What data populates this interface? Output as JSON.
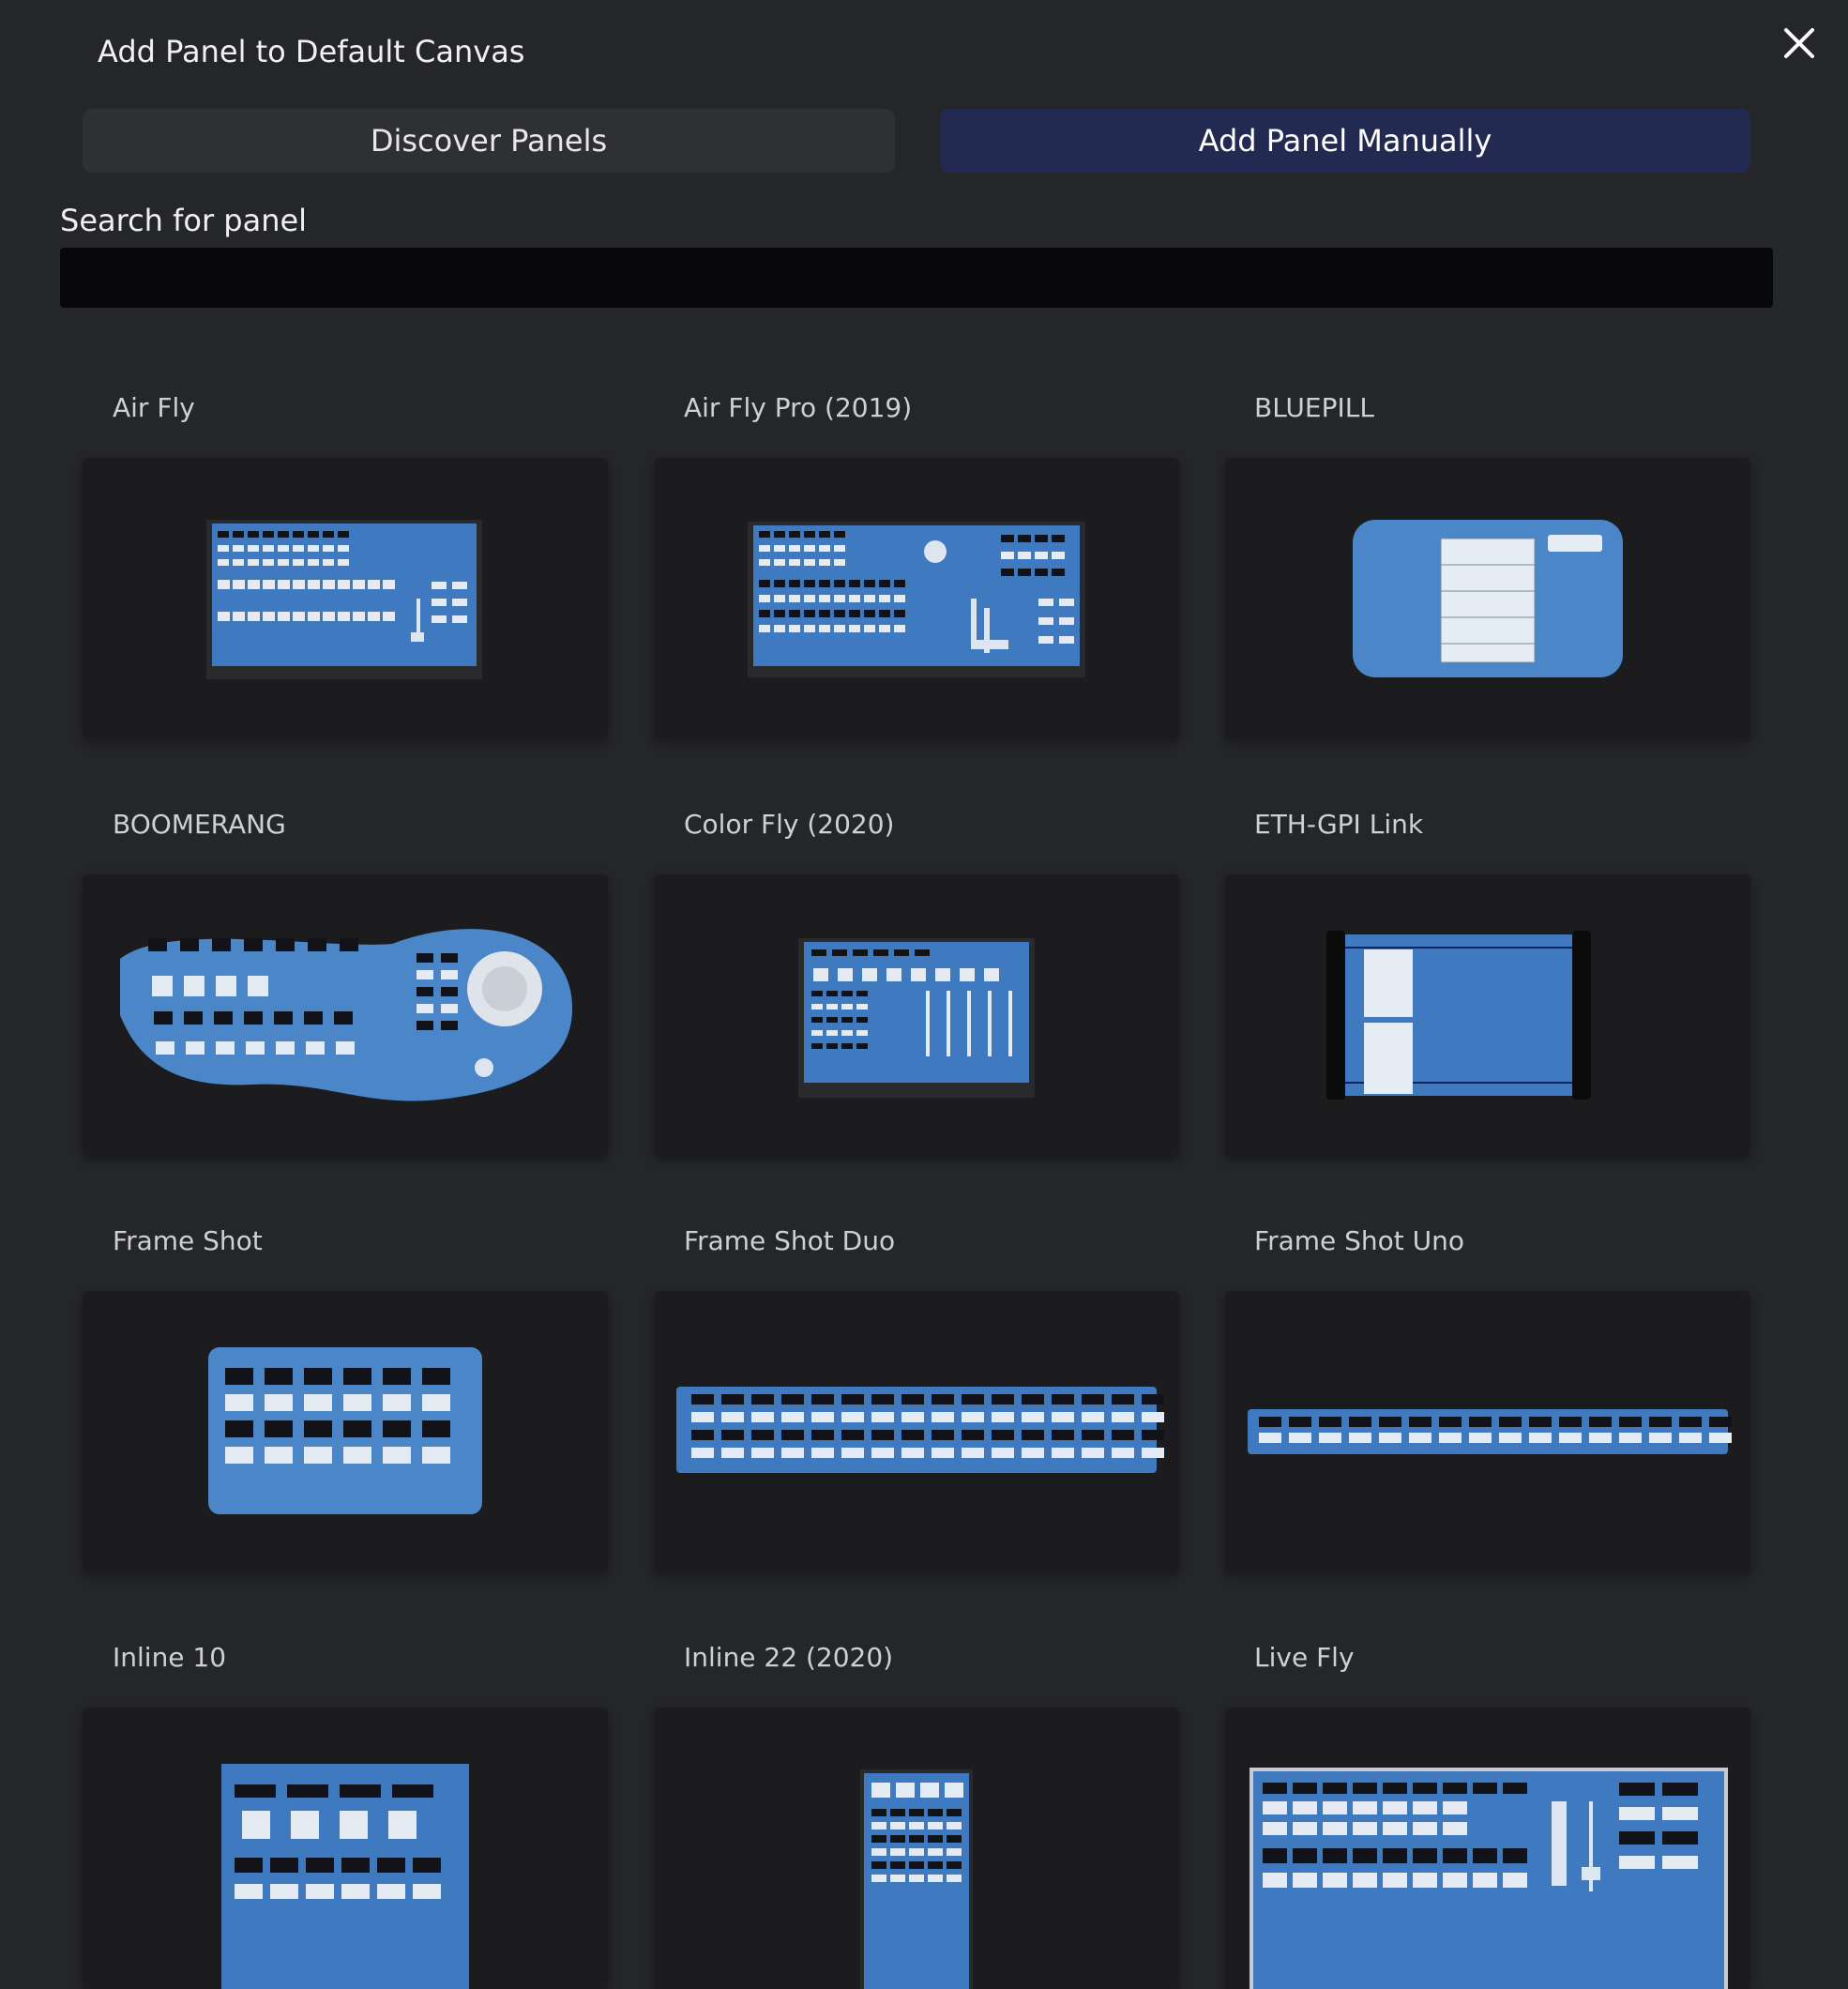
{
  "dialog": {
    "title": "Add Panel to Default Canvas",
    "close_icon": "close-icon"
  },
  "tabs": {
    "discover_label": "Discover Panels",
    "manual_label": "Add Panel Manually",
    "active": "manual"
  },
  "search": {
    "label": "Search for panel",
    "value": "",
    "placeholder": ""
  },
  "panels": [
    {
      "name": "Air Fly"
    },
    {
      "name": "Air Fly Pro (2019)"
    },
    {
      "name": "BLUEPILL"
    },
    {
      "name": "BOOMERANG"
    },
    {
      "name": "Color Fly (2020)"
    },
    {
      "name": "ETH-GPI Link"
    },
    {
      "name": "Frame Shot"
    },
    {
      "name": "Frame Shot Duo"
    },
    {
      "name": "Frame Shot Uno"
    },
    {
      "name": "Inline 10"
    },
    {
      "name": "Inline 22 (2020)"
    },
    {
      "name": "Live Fly"
    }
  ],
  "colors": {
    "background": "#25262a",
    "card": "#1c1c1e",
    "active_tab": "#232a52",
    "panel_blue": "#3f79c0"
  }
}
